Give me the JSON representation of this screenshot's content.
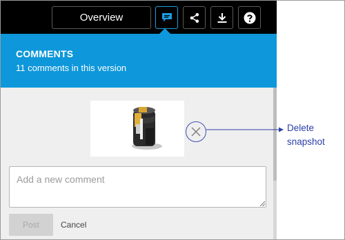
{
  "toolbar": {
    "overview_label": "Overview",
    "buttons": [
      {
        "name": "comments",
        "icon": "comment-icon",
        "active": true
      },
      {
        "name": "share",
        "icon": "share-icon"
      },
      {
        "name": "download",
        "icon": "download-icon"
      },
      {
        "name": "help",
        "icon": "help-icon"
      }
    ]
  },
  "comments": {
    "title": "COMMENTS",
    "subtitle": "11 comments in this version",
    "input_placeholder": "Add a new comment",
    "post_label": "Post",
    "cancel_label": "Cancel"
  },
  "callout": {
    "text": "Delete snapshot",
    "color": "#2a3fa8"
  },
  "colors": {
    "toolbar_bg": "#000000",
    "header_bg": "#0e97da",
    "panel_bg": "#efefef",
    "active_accent": "#1d9ee0"
  }
}
